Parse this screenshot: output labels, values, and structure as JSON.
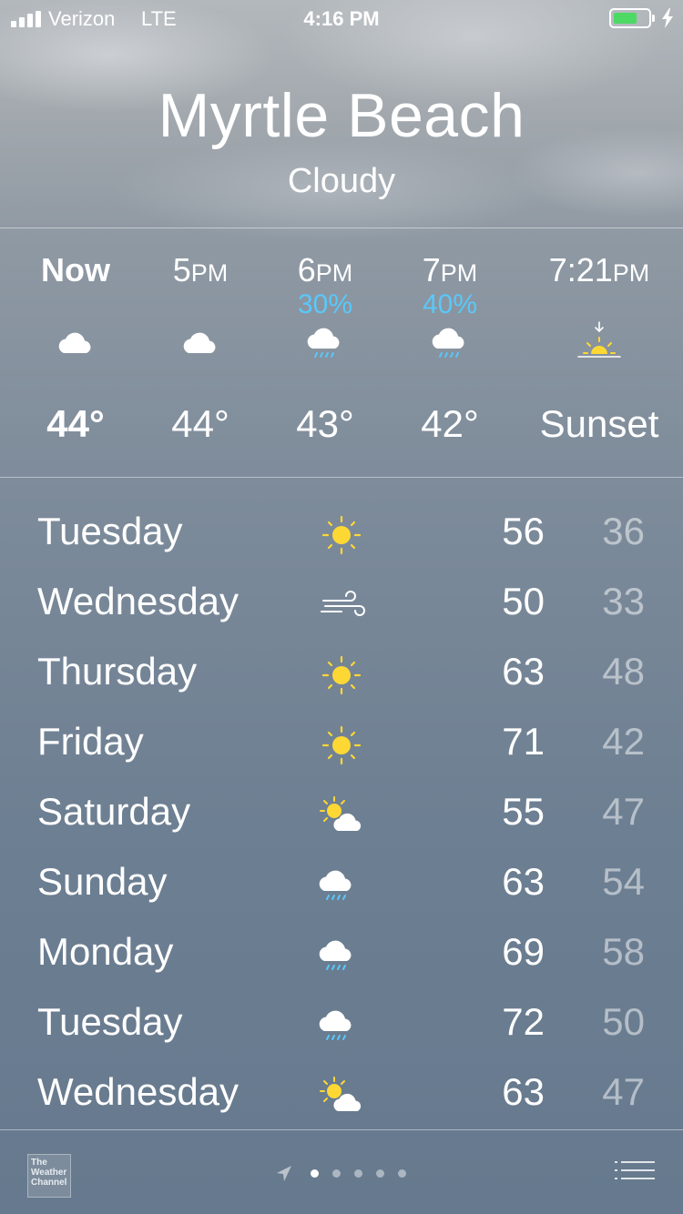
{
  "status_bar": {
    "carrier": "Verizon",
    "network": "LTE",
    "time": "4:16 PM",
    "battery_color": "#4cd964",
    "battery_level": 0.7
  },
  "location": {
    "city": "Myrtle Beach",
    "condition": "Cloudy"
  },
  "hourly": [
    {
      "label": "Now",
      "label_suffix": "",
      "pop": "",
      "icon": "cloud-icon",
      "temp": "44°"
    },
    {
      "label": "5",
      "label_suffix": "PM",
      "pop": "",
      "icon": "cloud-icon",
      "temp": "44°"
    },
    {
      "label": "6",
      "label_suffix": "PM",
      "pop": "30%",
      "icon": "rain-cloud-icon",
      "temp": "43°"
    },
    {
      "label": "7",
      "label_suffix": "PM",
      "pop": "40%",
      "icon": "rain-cloud-icon",
      "temp": "42°"
    },
    {
      "label": "7:21",
      "label_suffix": "PM",
      "pop": "",
      "icon": "sunset-icon",
      "temp": "Sunset"
    }
  ],
  "daily": [
    {
      "day": "Tuesday",
      "icon": "sun-icon",
      "high": "56",
      "low": "36"
    },
    {
      "day": "Wednesday",
      "icon": "wind-icon",
      "high": "50",
      "low": "33"
    },
    {
      "day": "Thursday",
      "icon": "sun-icon",
      "high": "63",
      "low": "48"
    },
    {
      "day": "Friday",
      "icon": "sun-icon",
      "high": "71",
      "low": "42"
    },
    {
      "day": "Saturday",
      "icon": "partly-cloudy-icon",
      "high": "55",
      "low": "47"
    },
    {
      "day": "Sunday",
      "icon": "rain-cloud-icon",
      "high": "63",
      "low": "54"
    },
    {
      "day": "Monday",
      "icon": "rain-cloud-icon",
      "high": "69",
      "low": "58"
    },
    {
      "day": "Tuesday",
      "icon": "rain-cloud-icon",
      "high": "72",
      "low": "50"
    },
    {
      "day": "Wednesday",
      "icon": "partly-cloudy-icon",
      "high": "63",
      "low": "47"
    }
  ],
  "footer": {
    "logo_lines": [
      "The",
      "Weather",
      "Channel"
    ],
    "page_count": 5,
    "active_page": 0
  },
  "colors": {
    "precip": "#5ac8fa",
    "sun": "#fdd835"
  }
}
